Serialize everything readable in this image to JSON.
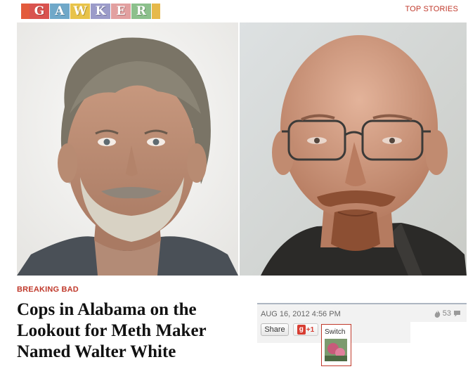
{
  "header": {
    "logo_letters": [
      "G",
      "A",
      "W",
      "K",
      "E",
      "R"
    ],
    "top_stories_label": "TOP STORIES",
    "colors": {
      "logo_tiles": [
        "#d9534f",
        "#6fa8c9",
        "#e8c34a",
        "#9b9bc9",
        "#e2a0a0",
        "#8cc08c"
      ],
      "logo_caps": [
        "#e35b3c",
        "#e6b94a"
      ],
      "top_stories": "#c0392b"
    }
  },
  "article": {
    "category": "BREAKING BAD",
    "headline": "Cops in Alabama on the Lookout for Meth Maker Named Walter White",
    "date": "AUG 16, 2012 4:56 PM",
    "comment_count": "53",
    "share_label": "Share",
    "gplus_label": "+1",
    "switch_label": "Switch"
  },
  "images": {
    "left": "mugshot-photo",
    "right": "walter-white-photo",
    "thumb": "switch-thumbnail"
  },
  "icons": {
    "flame": "flame-icon",
    "comment": "comment-bubble-icon",
    "gplus": "google-plus-icon"
  }
}
